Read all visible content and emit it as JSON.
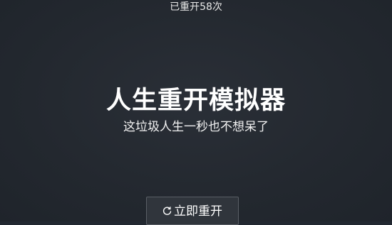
{
  "header": {
    "restart_count": "已重开58次"
  },
  "main": {
    "title": "人生重开模拟器",
    "subtitle": "这垃圾人生一秒也不想呆了"
  },
  "actions": {
    "restart_icon": "refresh-icon",
    "restart_label": "立即重开"
  },
  "colors": {
    "background": "#222831",
    "text": "#ffffff",
    "button_border": "#5a5f66"
  }
}
